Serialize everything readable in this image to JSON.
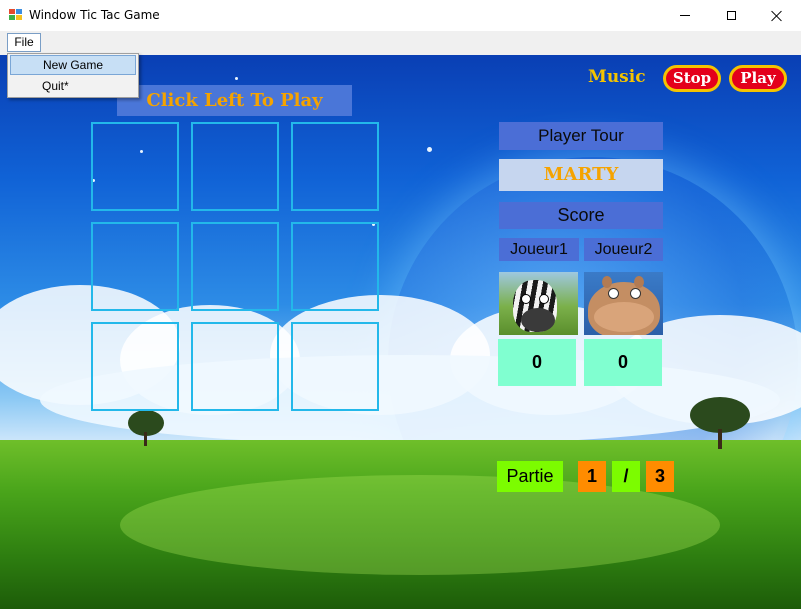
{
  "window": {
    "title": "Window Tic Tac Game"
  },
  "menu": {
    "file_label": "File",
    "items": [
      {
        "label": "New Game",
        "highlighted": true
      },
      {
        "label": "Quit*",
        "highlighted": false
      }
    ]
  },
  "game": {
    "instruction": "Click Left To Play",
    "board": [
      [
        "",
        "",
        ""
      ],
      [
        "",
        "",
        ""
      ],
      [
        "",
        "",
        ""
      ]
    ]
  },
  "music": {
    "label": "Music",
    "stop_label": "Stop",
    "play_label": "Play"
  },
  "status": {
    "player_tour_label": "Player Tour",
    "current_player": "MARTY",
    "score_label": "Score",
    "players": [
      {
        "name": "Joueur1",
        "avatar": "zebra-avatar",
        "score": "0"
      },
      {
        "name": "Joueur2",
        "avatar": "hippo-avatar",
        "score": "0"
      }
    ]
  },
  "round": {
    "label": "Partie",
    "current": "1",
    "separator": "/",
    "total": "3"
  },
  "colors": {
    "accent_orange": "#f5a300",
    "button_red": "#e4001b",
    "button_border": "#f5c400",
    "label_blue": "#4b6ed6",
    "score_mint": "#80ffd0",
    "round_green": "#7cfc00",
    "round_orange": "#ff8c00",
    "grid_cyan": "#23b8ea"
  }
}
